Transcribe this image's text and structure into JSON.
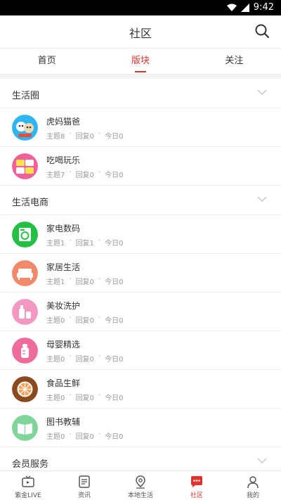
{
  "status_bar": {
    "time": "9:42"
  },
  "header": {
    "title": "社区"
  },
  "tabs": [
    {
      "label": "首页"
    },
    {
      "label": "版块"
    },
    {
      "label": "关注"
    }
  ],
  "sections": [
    {
      "title": "生活圈",
      "forums": [
        {
          "name": "虎妈猫爸",
          "topics": "主题8",
          "replies": "回复0",
          "today": "今日0",
          "icon": "tiger-cat-parents-icon"
        },
        {
          "name": "吃喝玩乐",
          "topics": "主题7",
          "replies": "回复0",
          "today": "今日0",
          "icon": "eat-drink-play-icon"
        }
      ]
    },
    {
      "title": "生活电商",
      "forums": [
        {
          "name": "家电数码",
          "topics": "主题1",
          "replies": "回复1",
          "today": "今日0",
          "icon": "washing-machine-icon"
        },
        {
          "name": "家居生活",
          "topics": "主题1",
          "replies": "回复0",
          "today": "今日0",
          "icon": "sofa-icon"
        },
        {
          "name": "美妆洗护",
          "topics": "主题0",
          "replies": "回复0",
          "today": "今日0",
          "icon": "cosmetics-icon"
        },
        {
          "name": "母婴精选",
          "topics": "主题0",
          "replies": "回复0",
          "today": "今日0",
          "icon": "baby-bottle-icon"
        },
        {
          "name": "食品生鲜",
          "topics": "主题0",
          "replies": "回复0",
          "today": "今日0",
          "icon": "orange-slice-icon"
        },
        {
          "name": "图书教辅",
          "topics": "主题0",
          "replies": "回复0",
          "today": "今日0",
          "icon": "book-icon"
        }
      ]
    },
    {
      "title": "会员服务"
    }
  ],
  "bottom_nav": [
    {
      "label": "紫金LIVE",
      "icon": "tv-icon"
    },
    {
      "label": "资讯",
      "icon": "news-icon"
    },
    {
      "label": "本地生活",
      "icon": "location-icon"
    },
    {
      "label": "社区",
      "icon": "community-icon"
    },
    {
      "label": "我的",
      "icon": "person-icon"
    }
  ],
  "colors": {
    "accent": "#e0322b",
    "divider": "#ededed",
    "meta": "#9a9a9a"
  },
  "layout_state": {
    "active_tab": "版块",
    "active_nav": "社区"
  }
}
